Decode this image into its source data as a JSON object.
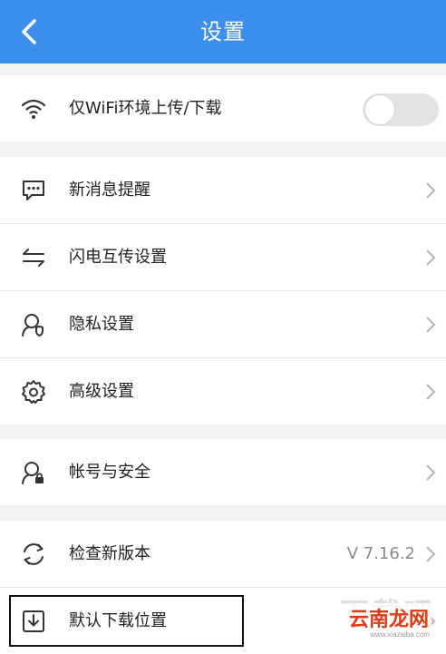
{
  "header": {
    "title": "设置"
  },
  "network_group": {
    "wifi_only_label": "仅WiFi环境上传/下载"
  },
  "message_group": {
    "items": [
      {
        "label": "新消息提醒"
      },
      {
        "label": "闪电互传设置"
      },
      {
        "label": "隐私设置"
      },
      {
        "label": "高级设置"
      }
    ]
  },
  "account_group": {
    "account_label": "帐号与安全"
  },
  "about_group": {
    "update_label": "检查新版本",
    "version": "V 7.16.2",
    "download_location_label": "默认下载位置"
  },
  "watermark": {
    "main": "云南龙网",
    "top": "下载吧",
    "url": "www.xiazaiba.com"
  },
  "colors": {
    "header_bg": "#3d8fee",
    "watermark_red": "#e03a16"
  }
}
